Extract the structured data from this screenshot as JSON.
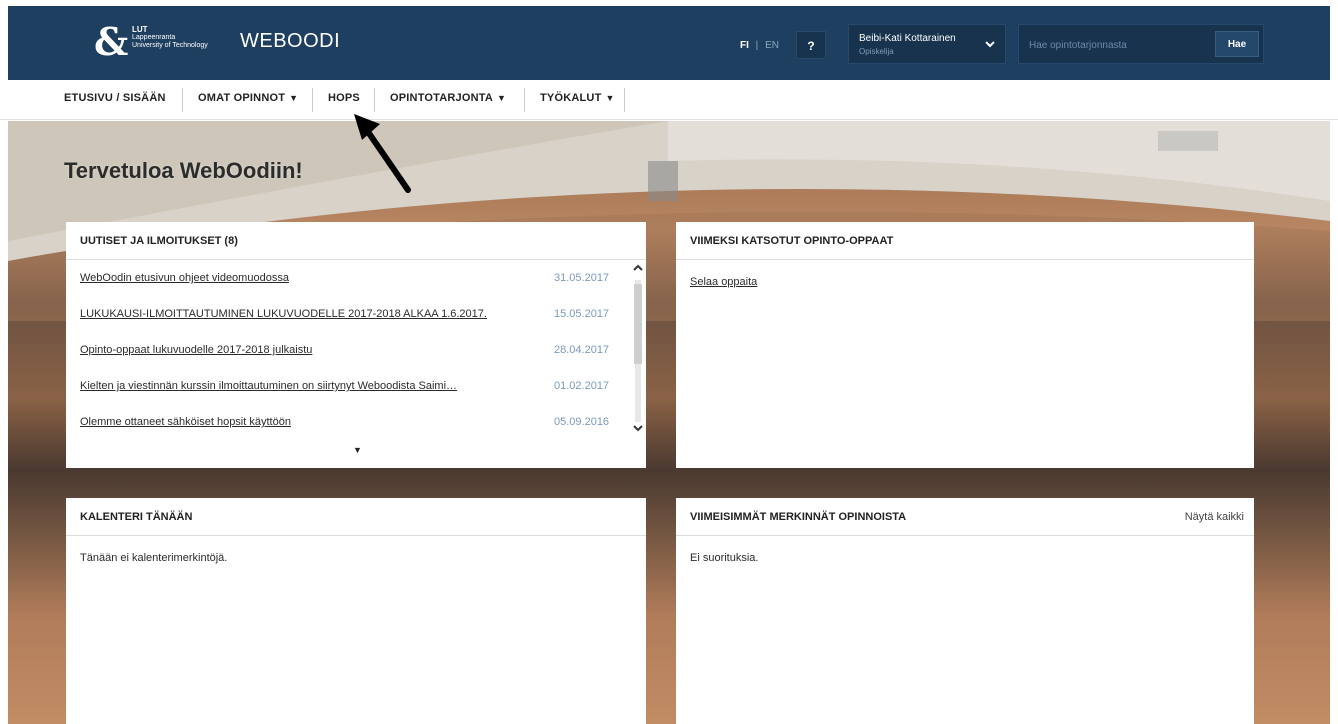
{
  "header": {
    "logo_name": "LUT",
    "logo_line1": "Lappeenranta",
    "logo_line2": "University of Technology",
    "app_title": "WEBOODI",
    "lang_fi": "FI",
    "lang_sep": "|",
    "lang_en": "EN",
    "help_label": "?",
    "user_name": "Beibi-Kati Kottarainen",
    "user_role": "Opiskelija",
    "search_placeholder": "Hae opintotarjonnasta",
    "search_button": "Hae"
  },
  "nav": {
    "items": [
      {
        "label": "ETUSIVU / SISÄÄN"
      },
      {
        "label": "OMAT OPINNOT"
      },
      {
        "label": "HOPS"
      },
      {
        "label": "OPINTOTARJONTA"
      },
      {
        "label": "TYÖKALUT"
      }
    ]
  },
  "main": {
    "welcome": "Tervetuloa WebOodiin!"
  },
  "news": {
    "title": "UUTISET JA ILMOITUKSET (8)",
    "items": [
      {
        "title": "WebOodin etusivun ohjeet videomuodossa",
        "date": "31.05.2017"
      },
      {
        "title": "LUKUKAUSI-ILMOITTAUTUMINEN LUKUVUODELLE 2017-2018 ALKAA 1.6.2017.",
        "date": "15.05.2017"
      },
      {
        "title": "Opinto-oppaat lukuvuodelle 2017-2018 julkaistu",
        "date": "28.04.2017"
      },
      {
        "title": "Kielten ja viestinnän kurssin ilmoittautuminen on siirtynyt Weboodista Saimi…",
        "date": "01.02.2017"
      },
      {
        "title": "Olemme ottaneet sähköiset hopsit käyttöön",
        "date": "05.09.2016"
      }
    ]
  },
  "guides": {
    "title": "VIIMEKSI KATSOTUT OPINTO-OPPAAT",
    "link": "Selaa oppaita"
  },
  "calendar": {
    "title": "KALENTERI TÄNÄÄN",
    "empty": "Tänään ei kalenterimerkintöjä."
  },
  "records": {
    "title": "VIIMEISIMMÄT MERKINNÄT OPINNOISTA",
    "show_all": "Näytä kaikki",
    "empty": "Ei suorituksia."
  },
  "colors": {
    "header_bg": "#1e3f5f",
    "date_text": "#7a9ab8"
  }
}
